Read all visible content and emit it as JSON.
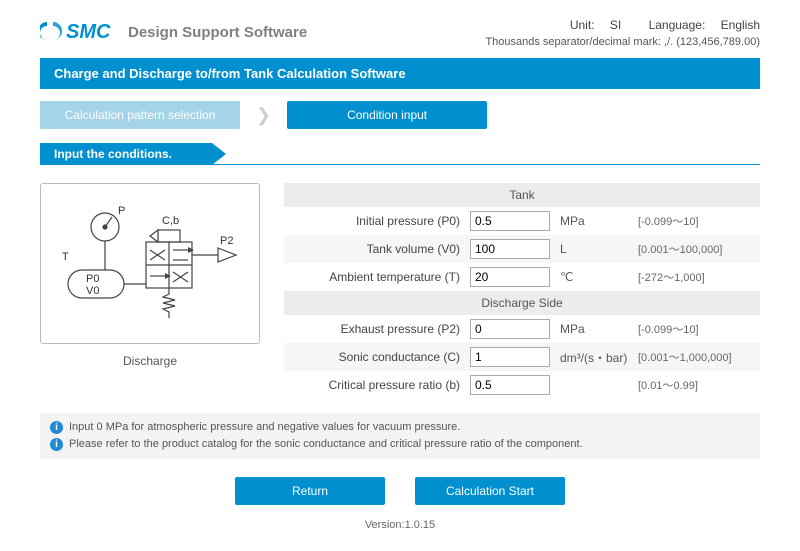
{
  "header": {
    "brand_title": "Design Support Software",
    "unit_label": "Unit:",
    "unit_value": "SI",
    "lang_label": "Language:",
    "lang_value": "English",
    "format_note": "Thousands separator/decimal mark: ,/. (123,456,789.00)"
  },
  "title_bar": "Charge and Discharge to/from Tank Calculation Software",
  "steps": {
    "step1": "Calculation pattern selection",
    "step2": "Condition input"
  },
  "instruction": "Input the conditions.",
  "diagram": {
    "caption": "Discharge",
    "labels": {
      "P": "P",
      "T": "T",
      "Cb": "C,b",
      "P0": "P0",
      "V0": "V0",
      "P2": "P2"
    }
  },
  "sections": {
    "tank": {
      "title": "Tank",
      "rows": {
        "p0": {
          "label": "Initial pressure (P0)",
          "value": "0.5",
          "unit": "MPa",
          "range": "[-0.099～10]"
        },
        "v0": {
          "label": "Tank volume (V0)",
          "value": "100",
          "unit": "L",
          "range": "[0.001～100,000]"
        },
        "t": {
          "label": "Ambient temperature (T)",
          "value": "20",
          "unit": "℃",
          "range": "[-272～1,000]"
        }
      }
    },
    "discharge": {
      "title": "Discharge Side",
      "rows": {
        "p2": {
          "label": "Exhaust pressure (P2)",
          "value": "0",
          "unit": "MPa",
          "range": "[-0.099～10]"
        },
        "c": {
          "label": "Sonic conductance (C)",
          "value": "1",
          "unit": "dm³/(s・bar)",
          "range": "[0.001～1,000,000]"
        },
        "b": {
          "label": "Critical pressure ratio (b)",
          "value": "0.5",
          "unit": "",
          "range": "[0.01～0.99]"
        }
      }
    }
  },
  "notes": {
    "n1": "Input 0 MPa for atmospheric pressure and negative values for vacuum pressure.",
    "n2": "Please refer to the product catalog for the sonic conductance and critical pressure ratio of the component."
  },
  "buttons": {
    "return": "Return",
    "start": "Calculation Start"
  },
  "version_label": "Version:",
  "version_value": "1.0.15"
}
